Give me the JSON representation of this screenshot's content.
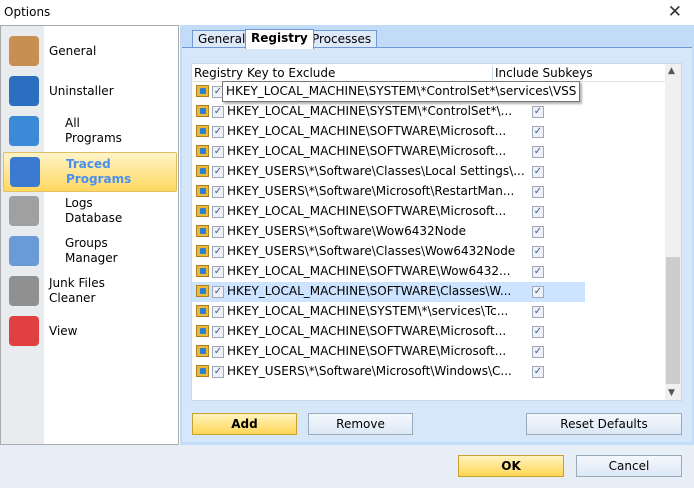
{
  "window": {
    "title": "Options",
    "close_icon": "close-icon"
  },
  "sidebar": {
    "items": [
      {
        "label": "General",
        "icon": "clipboard-check-icon",
        "selected": false,
        "indent": false
      },
      {
        "label": "Uninstaller",
        "icon": "uninstaller-icon",
        "selected": false,
        "indent": false
      },
      {
        "label": "All\nPrograms",
        "icon": "programs-box-icon",
        "selected": false,
        "indent": true
      },
      {
        "label": "Traced\nPrograms",
        "icon": "user-box-icon",
        "selected": true,
        "indent": true
      },
      {
        "label": "Logs\nDatabase",
        "icon": "database-icon",
        "selected": false,
        "indent": true
      },
      {
        "label": "Groups\nManager",
        "icon": "groups-icon",
        "selected": false,
        "indent": true
      },
      {
        "label": "Junk Files\nCleaner",
        "icon": "vacuum-icon",
        "selected": false,
        "indent": false
      },
      {
        "label": "View",
        "icon": "color-grid-gear-icon",
        "selected": false,
        "indent": false
      }
    ]
  },
  "tabs": [
    {
      "label": "General",
      "active": false
    },
    {
      "label": "Registry",
      "active": true
    },
    {
      "label": "Processes",
      "active": false
    }
  ],
  "table": {
    "columns": [
      "Registry Key to Exclude",
      "Include Subkeys"
    ],
    "tooltip": "HKEY_LOCAL_MACHINE\\SYSTEM\\*ControlSet*\\services\\VSS",
    "rows": [
      {
        "key": "HKEY_LOCAL_MACHINE\\SYSTEM\\*ControlSet*\\services\\VSS",
        "enabled": true,
        "subkeys": true
      },
      {
        "key": "HKEY_LOCAL_MACHINE\\SYSTEM\\*ControlSet*\\...",
        "enabled": true,
        "subkeys": true
      },
      {
        "key": "HKEY_LOCAL_MACHINE\\SOFTWARE\\Microsoft...",
        "enabled": true,
        "subkeys": true
      },
      {
        "key": "HKEY_LOCAL_MACHINE\\SOFTWARE\\Microsoft...",
        "enabled": true,
        "subkeys": true
      },
      {
        "key": "HKEY_USERS\\*\\Software\\Classes\\Local Settings\\...",
        "enabled": true,
        "subkeys": true
      },
      {
        "key": "HKEY_USERS\\*\\Software\\Microsoft\\RestartMan...",
        "enabled": true,
        "subkeys": true
      },
      {
        "key": "HKEY_LOCAL_MACHINE\\SOFTWARE\\Microsoft...",
        "enabled": true,
        "subkeys": true
      },
      {
        "key": "HKEY_USERS\\*\\Software\\Wow6432Node",
        "enabled": true,
        "subkeys": true
      },
      {
        "key": "HKEY_USERS\\*\\Software\\Classes\\Wow6432Node",
        "enabled": true,
        "subkeys": true
      },
      {
        "key": "HKEY_LOCAL_MACHINE\\SOFTWARE\\Wow6432...",
        "enabled": true,
        "subkeys": true
      },
      {
        "key": "HKEY_LOCAL_MACHINE\\SOFTWARE\\Classes\\W...",
        "enabled": true,
        "subkeys": true,
        "selected": true
      },
      {
        "key": "HKEY_LOCAL_MACHINE\\SYSTEM\\*\\services\\Tc...",
        "enabled": true,
        "subkeys": true
      },
      {
        "key": "HKEY_LOCAL_MACHINE\\SOFTWARE\\Microsoft...",
        "enabled": true,
        "subkeys": true
      },
      {
        "key": "HKEY_LOCAL_MACHINE\\SOFTWARE\\Microsoft...",
        "enabled": true,
        "subkeys": true
      },
      {
        "key": "HKEY_USERS\\*\\Software\\Microsoft\\Windows\\C...",
        "enabled": true,
        "subkeys": true
      }
    ]
  },
  "buttons": {
    "add": "Add",
    "remove": "Remove",
    "reset": "Reset Defaults",
    "ok": "OK",
    "cancel": "Cancel"
  }
}
